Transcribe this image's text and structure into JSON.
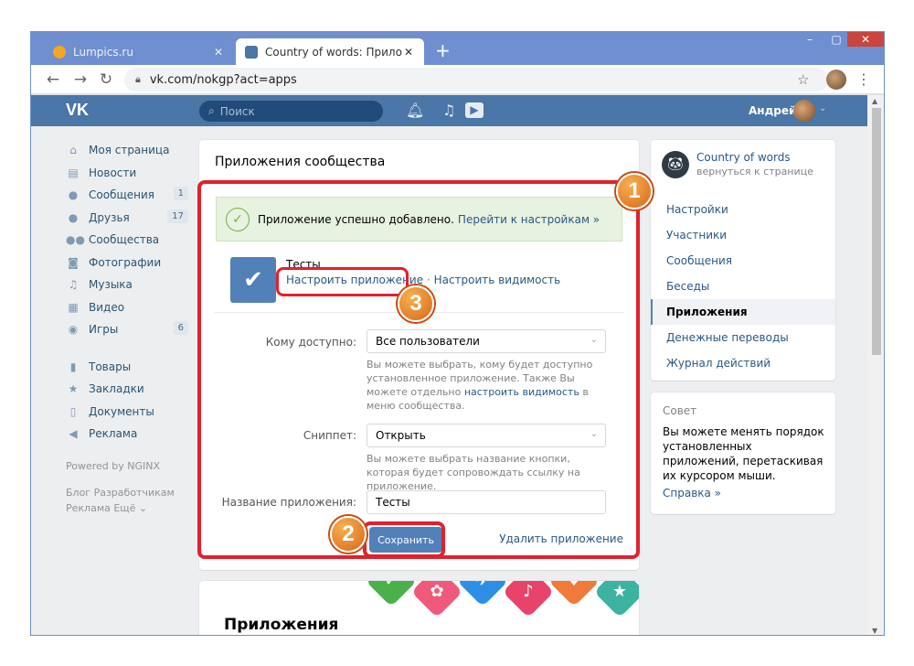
{
  "browser": {
    "tabs": [
      {
        "title": "Lumpics.ru",
        "favicon_color": "#f5a623",
        "favicon": "orange-circle-icon"
      },
      {
        "title": "Country of words: Приложения",
        "favicon_color": "#4a76a8",
        "favicon": "vk-icon"
      }
    ],
    "new_tab": "+",
    "close_glyph": "✕",
    "window_controls": [
      "–",
      "▢",
      "✕"
    ],
    "url": "vk.com/nokgp?act=apps",
    "nav": [
      "←",
      "→",
      "↻"
    ]
  },
  "vk": {
    "logo": "VK",
    "search_placeholder": "Поиск",
    "user_name": "Андрей",
    "header_color": "#4a76a8",
    "left_nav": [
      {
        "label": "Моя страница",
        "icon": "home-icon"
      },
      {
        "label": "Новости",
        "icon": "news-icon"
      },
      {
        "label": "Сообщения",
        "icon": "messages-icon",
        "badge": "1"
      },
      {
        "label": "Друзья",
        "icon": "friends-icon",
        "badge": "17"
      },
      {
        "label": "Сообщества",
        "icon": "communities-icon"
      },
      {
        "label": "Фотографии",
        "icon": "camera-icon"
      },
      {
        "label": "Музыка",
        "icon": "music-icon"
      },
      {
        "label": "Видео",
        "icon": "video-icon"
      },
      {
        "label": "Игры",
        "icon": "games-icon",
        "badge": "6"
      }
    ],
    "left_nav2": [
      {
        "label": "Товары",
        "icon": "goods-icon"
      },
      {
        "label": "Закладки",
        "icon": "star-icon"
      },
      {
        "label": "Документы",
        "icon": "document-icon"
      },
      {
        "label": "Реклама",
        "icon": "megaphone-icon"
      }
    ],
    "powered_by": "Powered by NGINX",
    "footer_links_1": "Блог  Разработчикам",
    "footer_links_2": "Реклама  Ещё ⌄"
  },
  "main": {
    "title": "Приложения сообщества",
    "success_text": "Приложение успешно добавлено.",
    "success_link": "Перейти к настройкам »",
    "app_name": "Тесты",
    "app_link_configure": "Настроить приложение",
    "app_link_visibility": "Настроить видимость",
    "access_label": "Кому доступно:",
    "access_value": "Все пользователи",
    "access_hint_1": "Вы можете выбрать, кому будет доступно установленное приложение. Также Вы можете отдельно",
    "access_hint_link": "настроить видимость",
    "access_hint_2": "в меню сообщества.",
    "snippet_label": "Сниппет:",
    "snippet_value": "Открыть",
    "snippet_hint": "Вы можете выбрать название кнопки, которая будет сопровождать ссылку на приложение.",
    "appname_label": "Название приложения:",
    "appname_value": "Тесты",
    "save_label": "Сохранить",
    "delete_label": "Удалить приложение"
  },
  "apps_card": {
    "title": "Приложения"
  },
  "right_menu": {
    "group_name": "Country of words",
    "group_back": "вернуться к странице",
    "items": [
      "Настройки",
      "Участники",
      "Сообщения",
      "Беседы",
      "Приложения",
      "Денежные переводы",
      "Журнал действий"
    ],
    "active_index": 4
  },
  "tip": {
    "title": "Совет",
    "text": "Вы можете менять порядок установленных приложений, перетаскивая их курсором мыши.",
    "link": "Справка »"
  },
  "annotations": {
    "callouts": [
      "1",
      "2",
      "3"
    ],
    "highlight_color": "#e3202b"
  }
}
